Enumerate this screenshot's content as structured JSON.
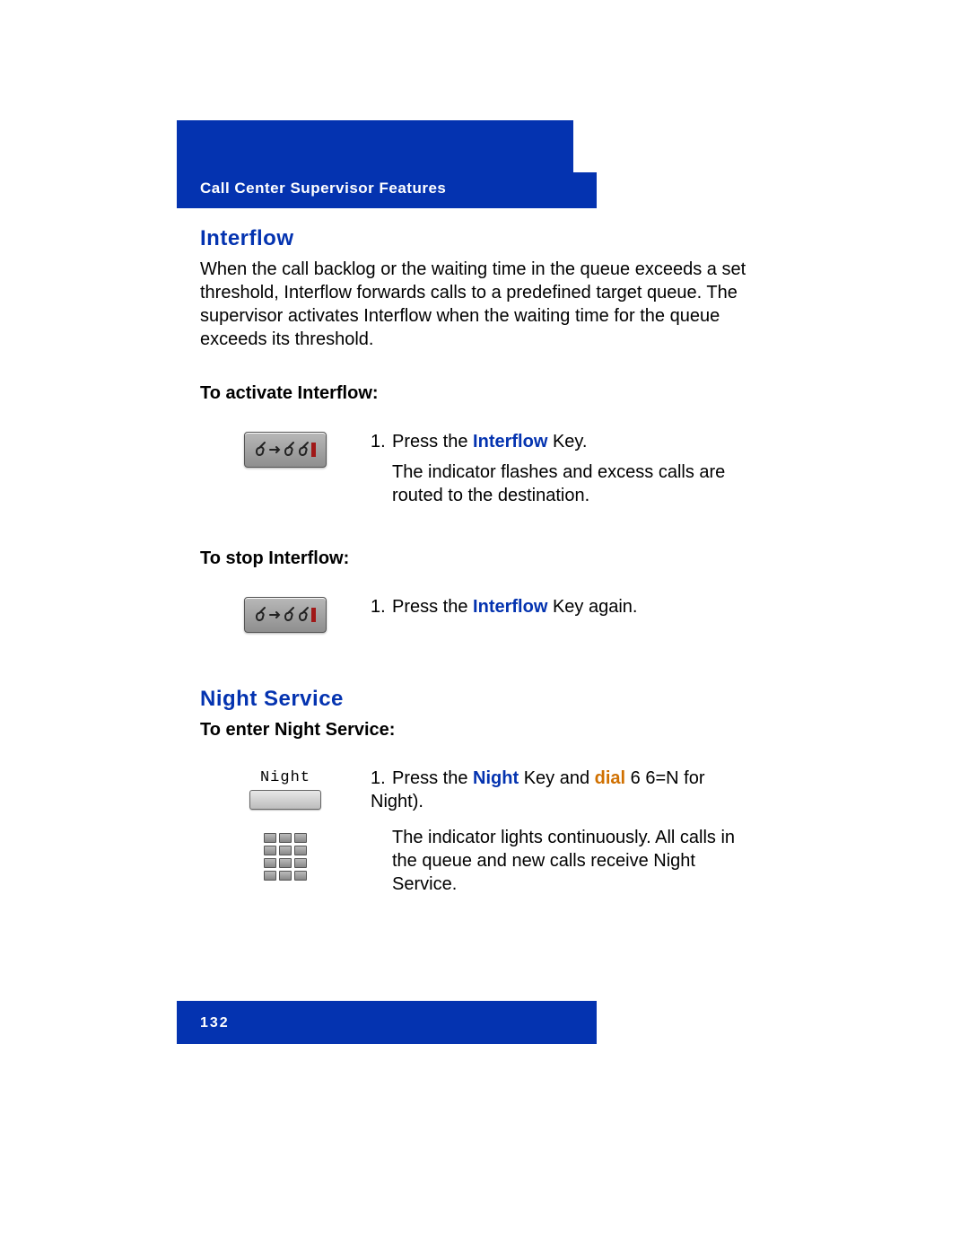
{
  "header": {
    "title": "Call Center Supervisor Features"
  },
  "interflow": {
    "heading": "Interflow",
    "description": "When the call backlog or the waiting time in the queue exceeds a set threshold, Interflow forwards calls to a predefined target queue. The supervisor activates Interflow when the waiting time for the queue exceeds its threshold.",
    "activate": {
      "heading": "To activate Interflow:",
      "step_number": "1.",
      "step_pre": "Press the ",
      "step_link": "Interflow",
      "step_post": " Key.",
      "follow": "The indicator flashes and excess calls are routed to the destination."
    },
    "stop": {
      "heading": "To stop Interflow:",
      "step_number": "1.",
      "step_pre": "Press the ",
      "step_link": "Interflow",
      "step_post": " Key again."
    }
  },
  "night": {
    "heading": "Night Service",
    "enter": {
      "heading": "To enter Night Service:",
      "step_number": "1.",
      "step_pre": "Press the ",
      "step_link1": "Night",
      "step_mid": " Key and ",
      "step_link2": "dial",
      "step_post": " 6 6=N for Night).",
      "follow": "The indicator lights continuously. All calls in the queue and new calls receive Night Service.",
      "key_label": "Night"
    }
  },
  "footer": {
    "page_number": "132"
  }
}
